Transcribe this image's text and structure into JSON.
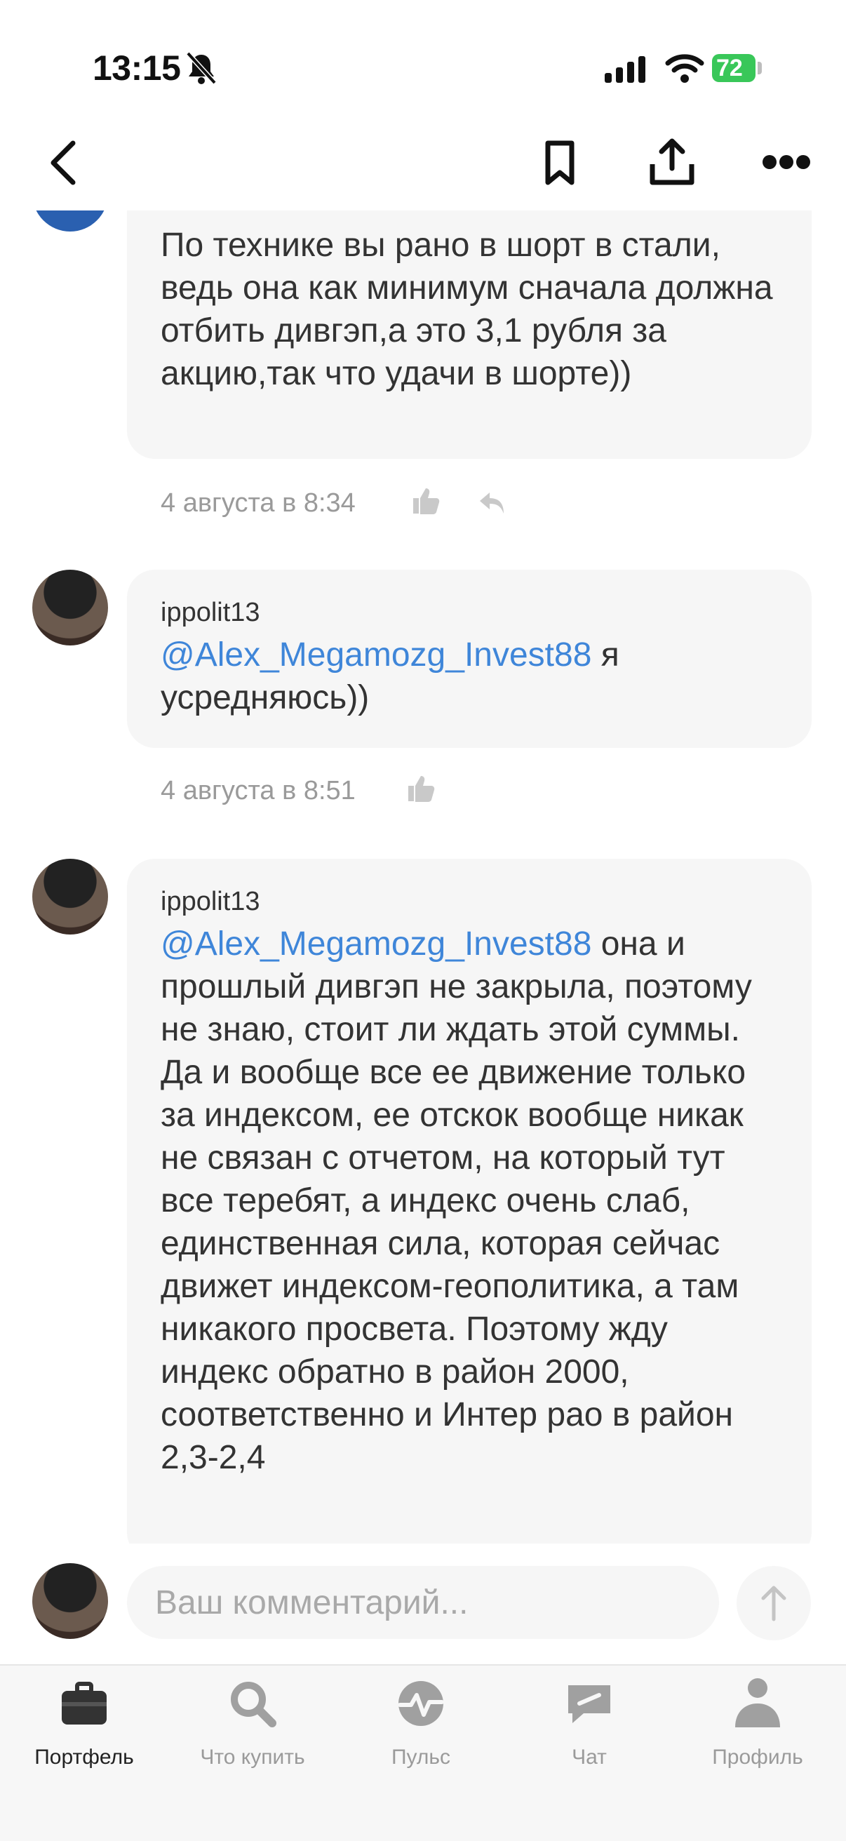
{
  "status_bar": {
    "time": "13:15",
    "battery": "72"
  },
  "messages": [
    {
      "text": "По технике вы рано в шорт в стали, ведь она как минимум сначала должна отбить дивгэп,а это 3,1 рубля за акцию,так что удачи в шорте))",
      "date": "4 августа в 8:34"
    },
    {
      "author": "ippolit13",
      "mention": "@Alex_Megamozg_Invest88",
      "text": " я усредняюсь))",
      "date": "4 августа в 8:51"
    },
    {
      "author": "ippolit13",
      "mention": "@Alex_Megamozg_Invest88",
      "text": " она и прошлый дивгэп не закрыла, поэтому не знаю, стоит ли ждать этой суммы. Да и вообще все ее движение  только за индексом, ее отскок вообще никак не связан с отчетом, на который тут все теребят, а индекс очень слаб, единственная сила, которая сейчас движет индексом-геополитика, а там никакого просвета. Поэтому жду индекс обратно в район 2000, соответственно и Интер рао в район 2,3-2,4"
    }
  ],
  "comment_input": {
    "placeholder": "Ваш комментарий..."
  },
  "tabs": [
    {
      "label": "Портфель",
      "icon": "briefcase-icon"
    },
    {
      "label": "Что купить",
      "icon": "search-icon"
    },
    {
      "label": "Пульс",
      "icon": "pulse-icon"
    },
    {
      "label": "Чат",
      "icon": "chat-icon"
    },
    {
      "label": "Профиль",
      "icon": "profile-icon"
    }
  ],
  "colors": {
    "accent": "#3f86d9",
    "bubble": "#f6f6f6",
    "battery": "#39c759"
  }
}
